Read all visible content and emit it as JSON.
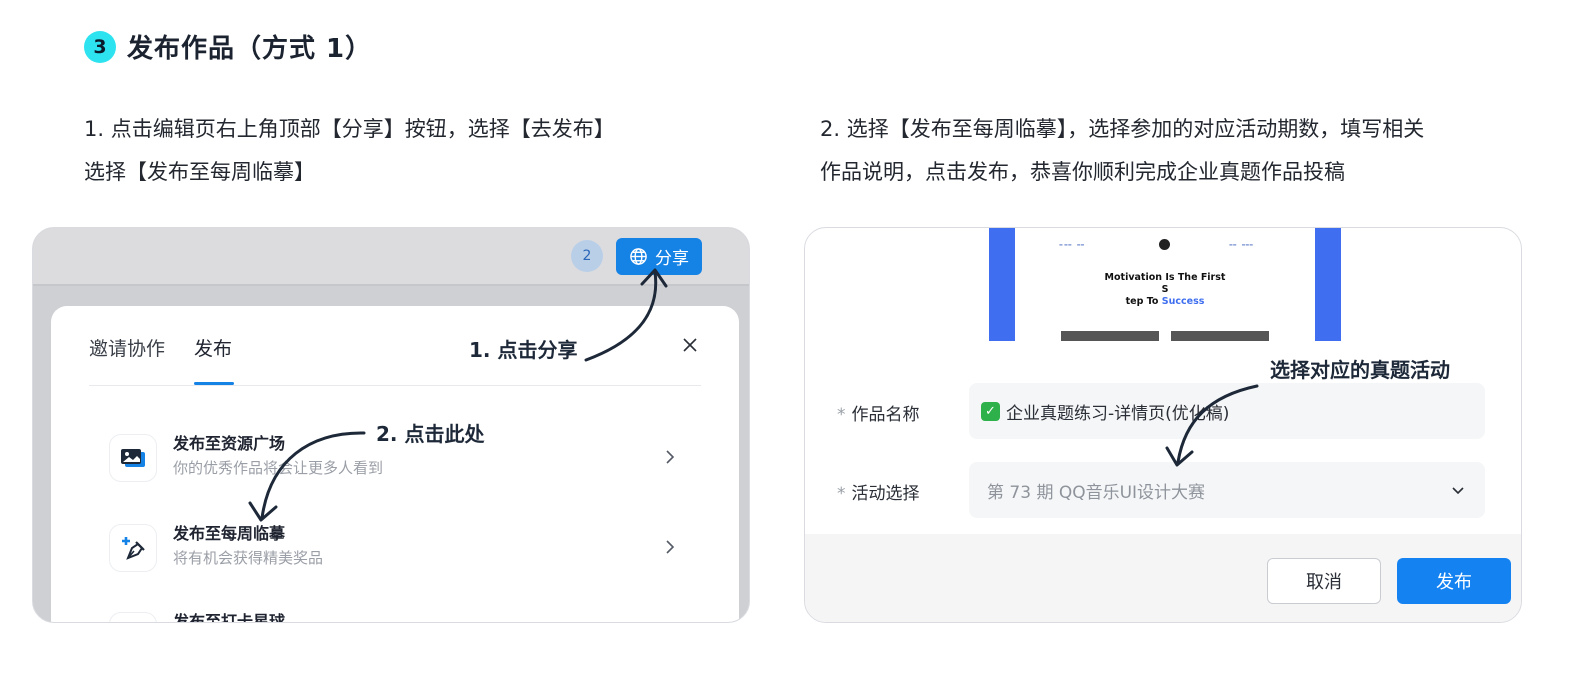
{
  "step": {
    "number": "3",
    "title": "发布作品（方式 1）"
  },
  "instructions": [
    {
      "line1": "1. 点击编辑页右上角顶部【分享】按钮，选择【去发布】",
      "line2": "选择【发布至每周临摹】"
    },
    {
      "line1": "2. 选择【发布至每周临摹】，选择参加的对应活动期数，填写相关",
      "line2": "作品说明，点击发布，恭喜你顺利完成企业真题作品投稿"
    }
  ],
  "panel1": {
    "collaborator_count": "2",
    "share_label": "分享",
    "tabs": [
      {
        "label": "邀请协作"
      },
      {
        "label": "发布",
        "active": true
      }
    ],
    "publish_options": [
      {
        "title": "发布至资源广场",
        "desc": "你的优秀作品将会让更多人看到",
        "icon": "image-gallery-icon"
      },
      {
        "title": "发布至每周临摹",
        "desc": "将有机会获得精美奖品",
        "icon": "pen-plus-icon"
      },
      {
        "title": "发布至打卡星球",
        "desc": "",
        "icon": "planet-icon"
      }
    ],
    "annotations": {
      "click_share": "1. 点击分享",
      "click_here": "2. 点击此处"
    }
  },
  "panel2": {
    "preview": {
      "headline_part1": "Motivation Is The First S",
      "headline_part2": "tep To ",
      "headline_accent": "Success"
    },
    "annotation": "选择对应的真题活动",
    "fields": {
      "name_label": "作品名称",
      "name_value": "企业真题练习-详情页(优化稿)",
      "activity_label": "活动选择",
      "activity_value": "第 73 期 QQ音乐UI设计大赛",
      "required_mark": "*"
    },
    "buttons": {
      "cancel": "取消",
      "publish": "发布"
    }
  },
  "colors": {
    "accent": "#1582e6",
    "badge": "#2ee3f0",
    "preview_blue": "#3f6ff0"
  }
}
